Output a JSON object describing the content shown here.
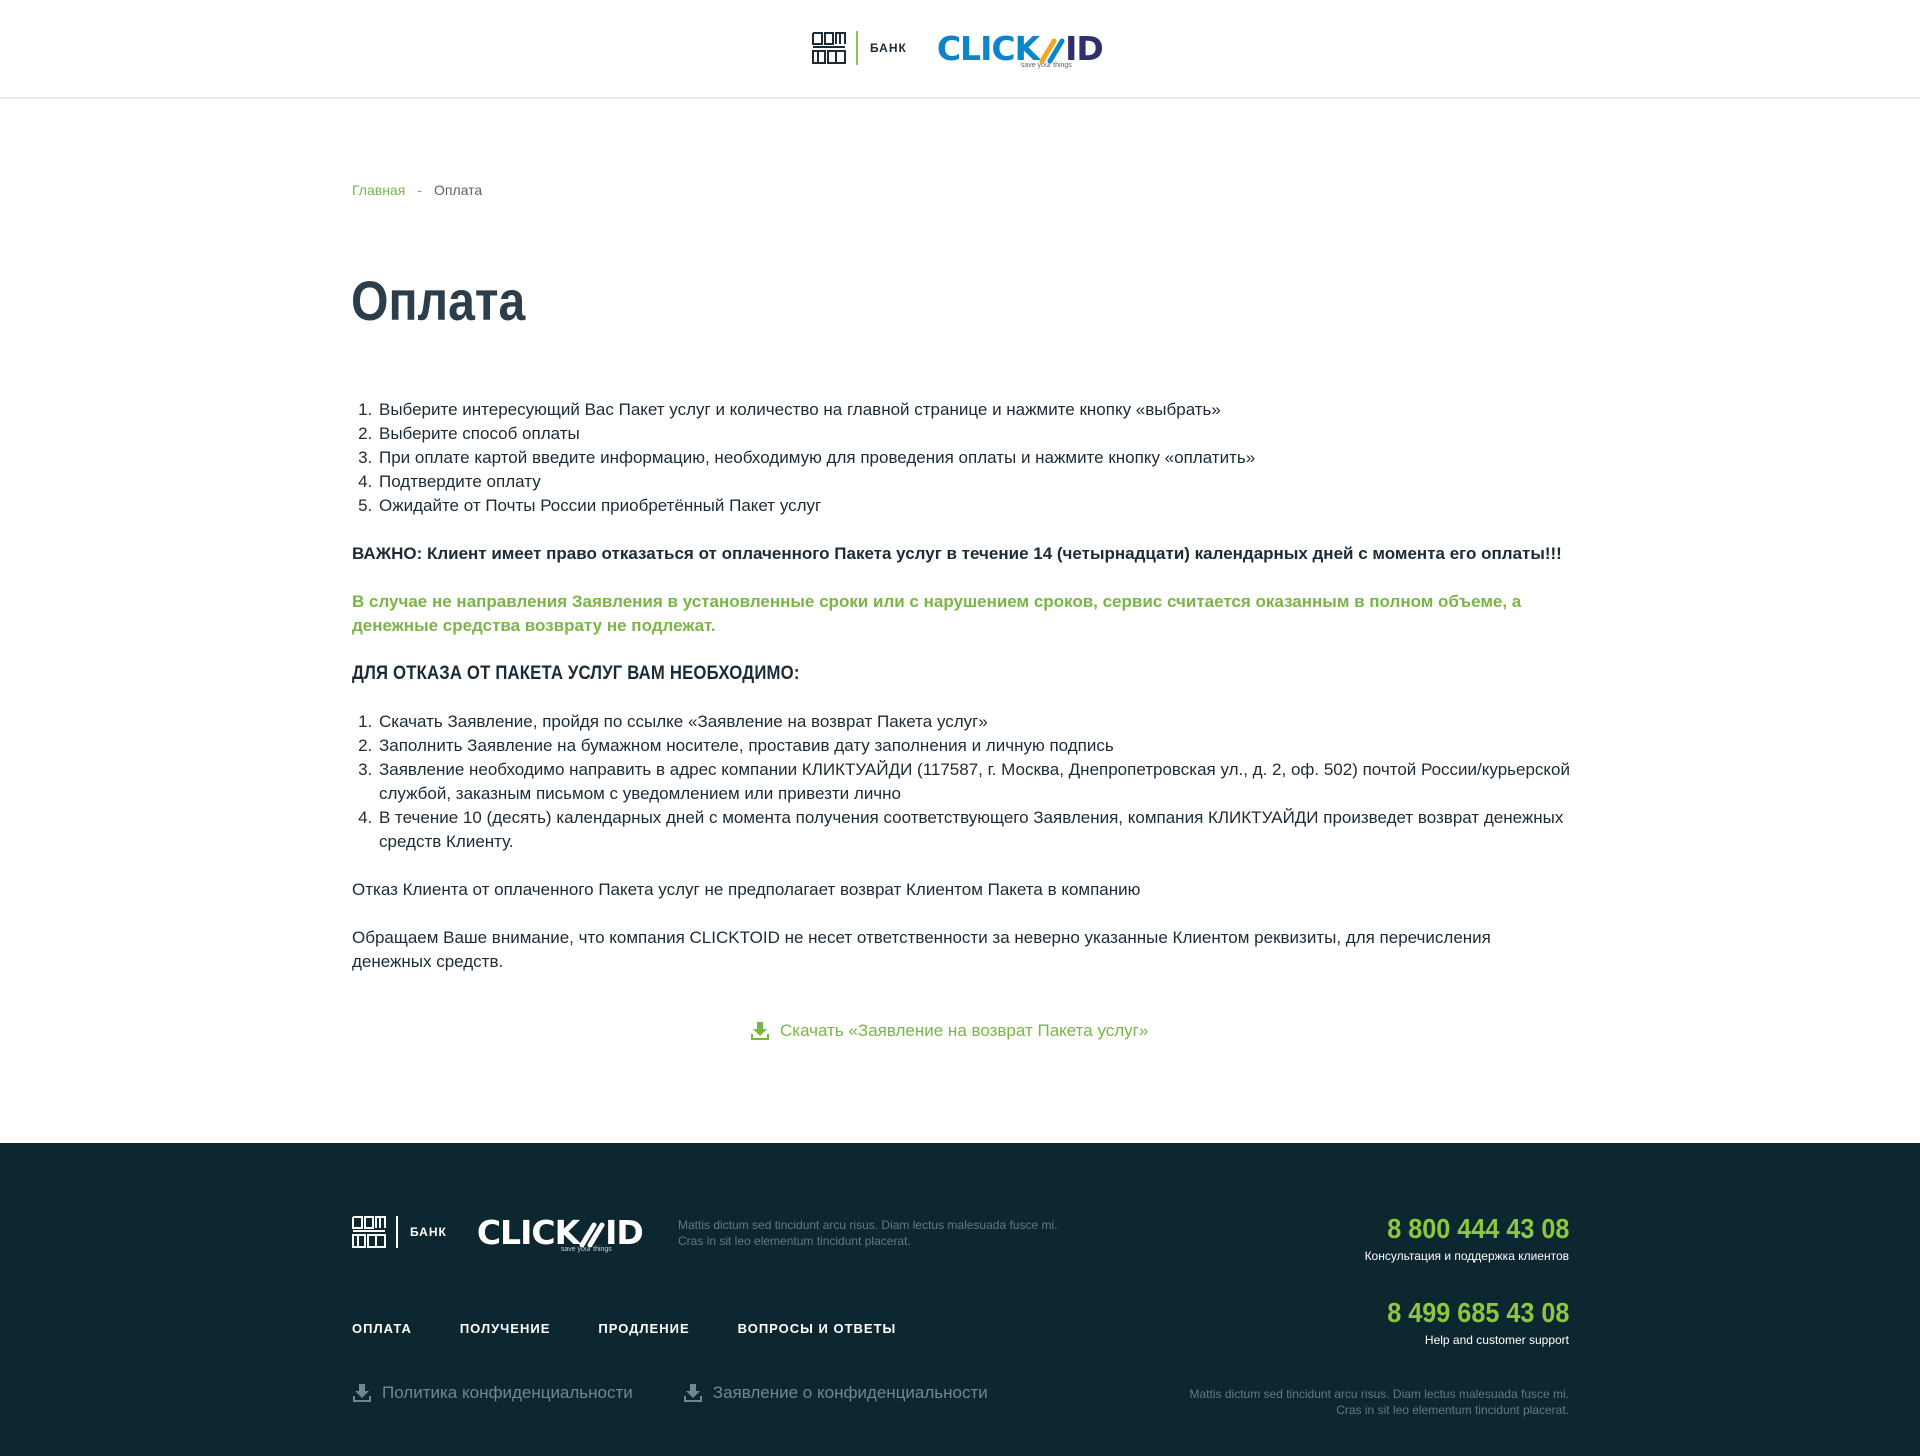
{
  "header": {
    "bank_label": "БАНК",
    "logo_click": "CLICK",
    "logo_id": "ID",
    "logo_tagline": "save your things"
  },
  "breadcrumb": {
    "home": "Главная",
    "separator": "-",
    "current": "Оплата"
  },
  "page": {
    "title": "Оплата",
    "steps": [
      "Выберите интересующий Вас Пакет услуг и количество на главной странице и нажмите кнопку «выбрать»",
      "Выберите способ оплаты",
      "При оплате картой введите информацию, необходимую для проведения оплаты и нажмите кнопку «оплатить»",
      "Подтвердите оплату",
      "Ожидайте от Почты России приобретённый Пакет услуг"
    ],
    "important": "ВАЖНО: Клиент имеет право отказаться от оплаченного Пакета услуг в течение 14 (четырнадцати) календарных дней с момента его оплаты!!!",
    "green_note": "В случае не направления Заявления в установленные сроки или с нарушением сроков, сервис считается оказанным в полном объеме, а денежные средства возврату не подлежат.",
    "refund_heading": "ДЛЯ ОТКАЗА ОТ ПАКЕТА УСЛУГ ВАМ НЕОБХОДИМО:",
    "refund_steps": [
      "Скачать Заявление, пройдя по ссылке «Заявление на возврат Пакета услуг»",
      "Заполнить Заявление на бумажном носителе, проставив дату заполнения и личную подпись",
      "Заявление необходимо направить в адрес компании КЛИКТУАЙДИ (117587, г. Москва, Днепропетровская ул., д. 2, оф. 502) почтой России/курьерской службой, заказным письмом с уведомлением или привезти лично",
      "В течение 10 (десять) календарных дней с момента получения соответствующего Заявления, компания КЛИКТУАЙДИ произведет возврат денежных средств Клиенту."
    ],
    "refusal_note": "Отказ Клиента от оплаченного Пакета услуг не предполагает возврат Клиентом Пакета в компанию",
    "attention_note": "Обращаем Ваше внимание, что компания CLICKTOID не несет ответственности за неверно указанные Клиентом реквизиты, для перечисления денежных средств.",
    "download_label": "Скачать «Заявление на возврат Пакета услуг»"
  },
  "footer": {
    "bank_label": "БАНК",
    "logo_click": "CLICK",
    "logo_id": "ID",
    "logo_tagline": "save your things",
    "description": "Mattis dictum sed tincidunt arcu risus. Diam lectus malesuada fusce mi. Cras in sit leo elementum tincidunt placerat.",
    "phone1": "8 800 444 43 08",
    "phone1_caption": "Консультация и поддержка клиентов",
    "phone2": "8 499 685 43 08",
    "phone2_caption": "Help and customer support",
    "nav": [
      "ОПЛАТА",
      "ПОЛУЧЕНИЕ",
      "ПРОДЛЕНИЕ",
      "ВОПРОСЫ И ОТВЕТЫ"
    ],
    "privacy_policy": "Политика конфиденциальности",
    "privacy_statement": "Заявление о конфиденциальности",
    "description2": "Mattis dictum sed tincidunt arcu risus. Diam lectus malesuada fusce mi. Cras in sit leo elementum tincidunt placerat."
  },
  "colors": {
    "accent_green": "#7ab547",
    "footer_bg": "#0d2731",
    "text_dark": "#1c2b36"
  }
}
